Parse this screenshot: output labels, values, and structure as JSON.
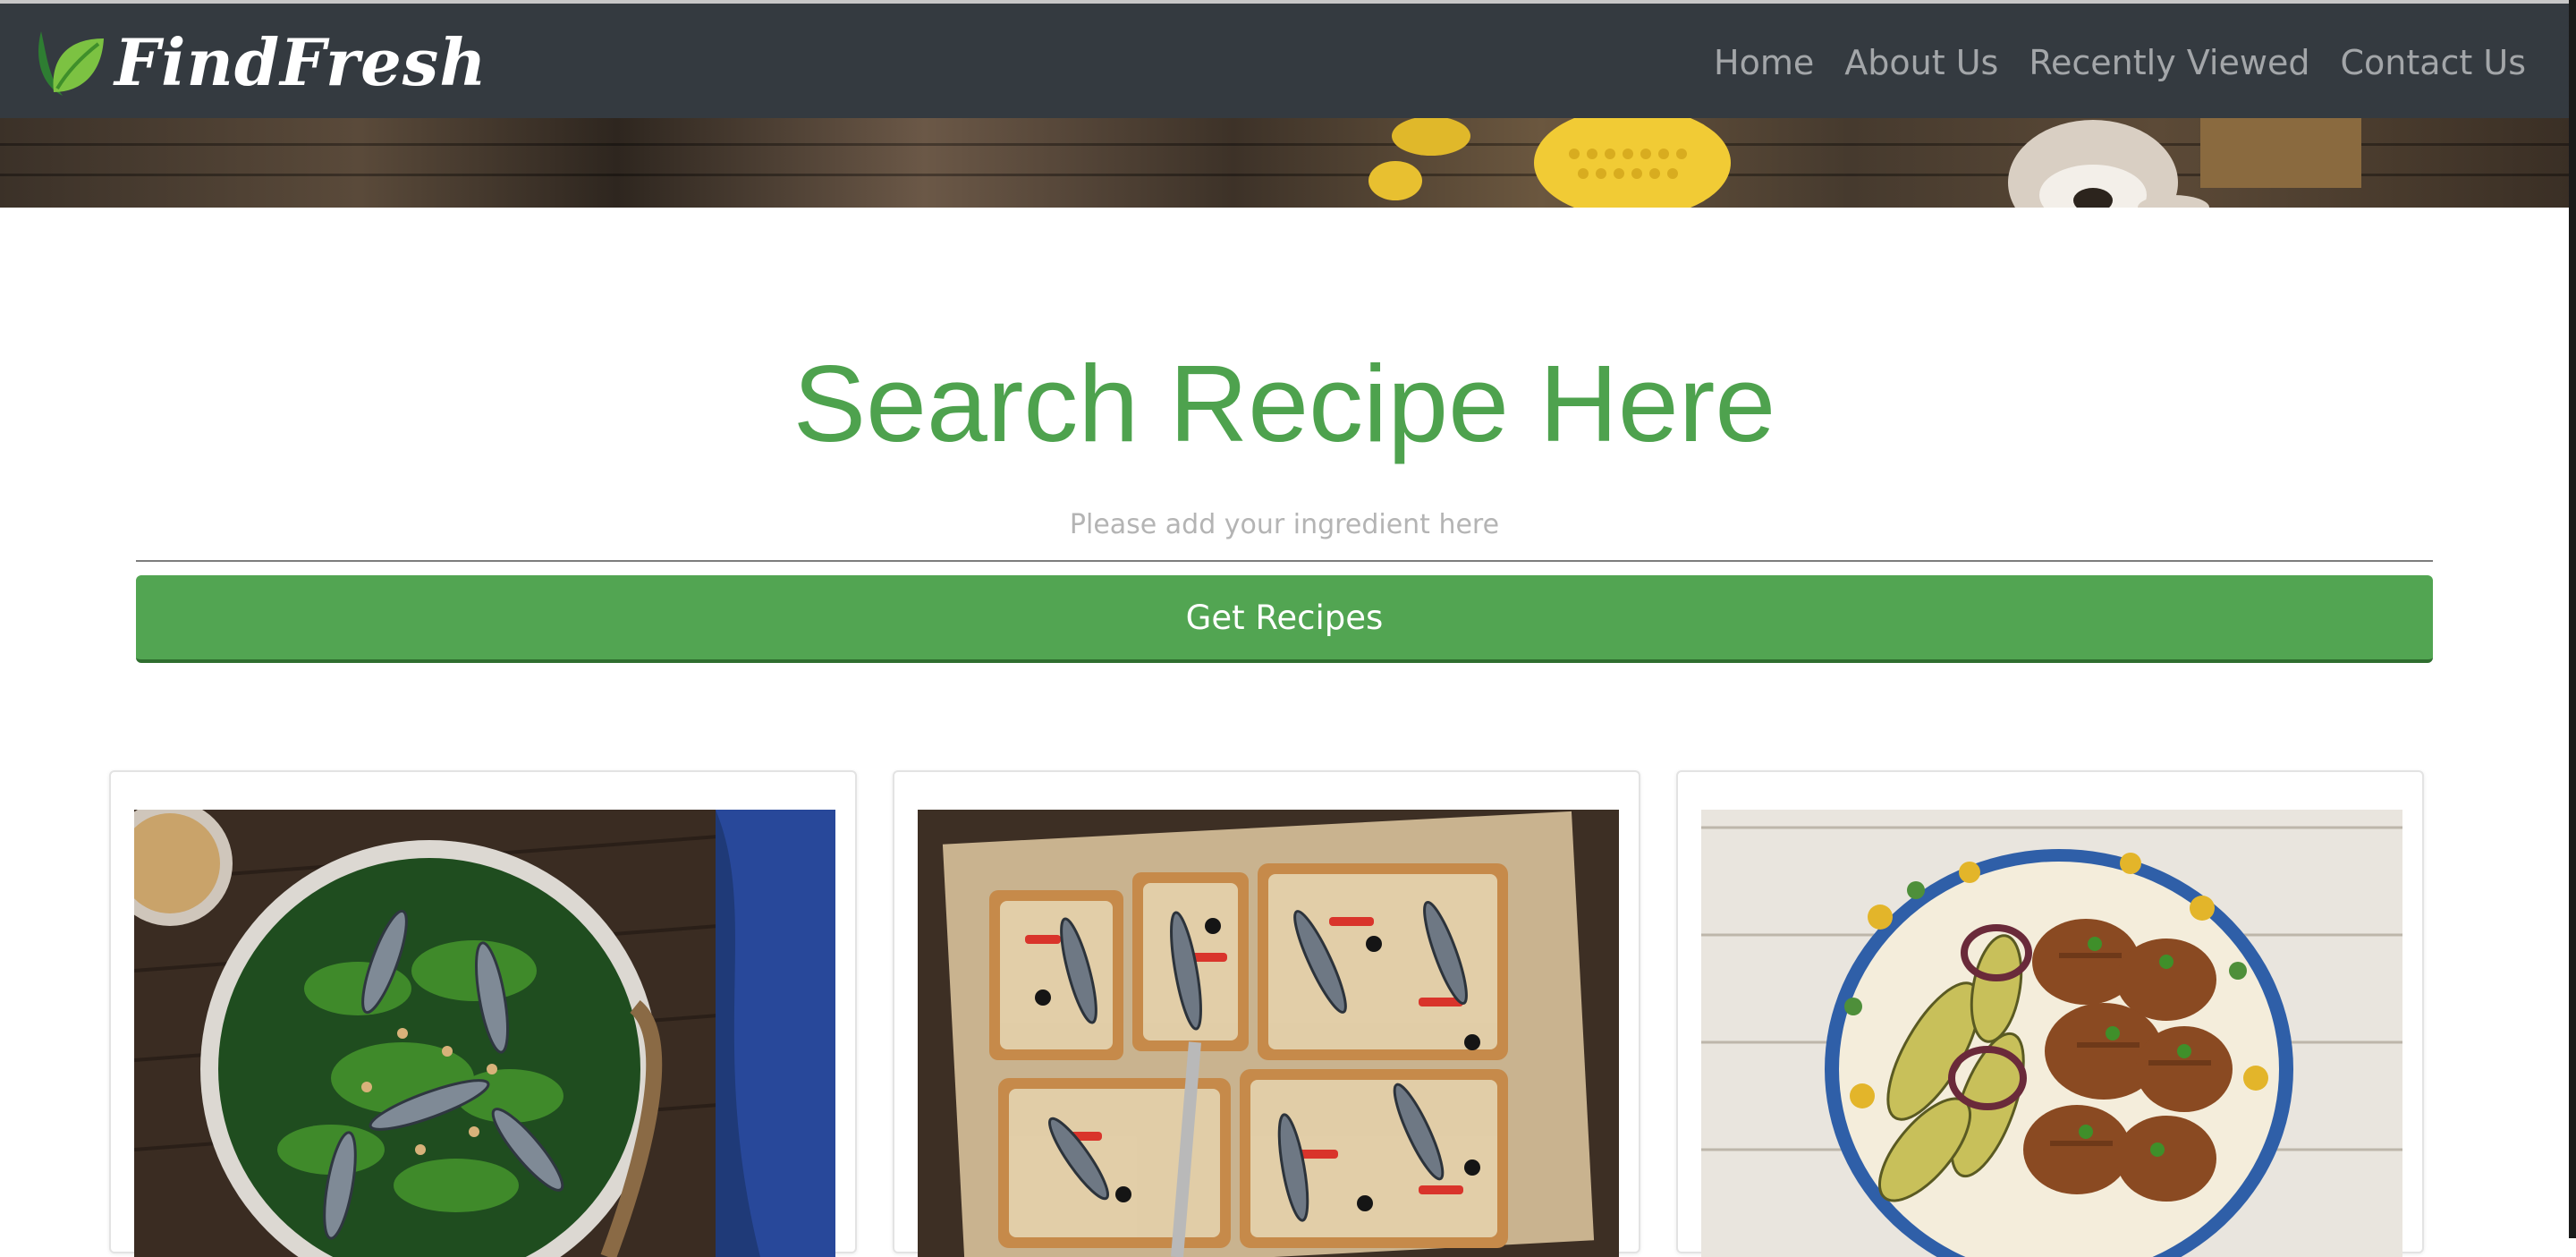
{
  "brand": {
    "name": "FindFresh",
    "logo_icon": "leaf-icon"
  },
  "nav": {
    "items": [
      {
        "label": "Home"
      },
      {
        "label": "About Us"
      },
      {
        "label": "Recently Viewed"
      },
      {
        "label": "Contact Us"
      }
    ]
  },
  "search": {
    "title": "Search Recipe Here",
    "placeholder": "Please add your ingredient here",
    "value": "",
    "button_label": "Get Recipes"
  },
  "colors": {
    "navbar": "#343a40",
    "accent_green": "#52a552",
    "title_green": "#4ea24e"
  },
  "recipes": [
    {
      "image_icon": "recipe-image-sardine-salad"
    },
    {
      "image_icon": "recipe-image-sardine-flatbread"
    },
    {
      "image_icon": "recipe-image-grilled-chicken-vegetables"
    }
  ]
}
